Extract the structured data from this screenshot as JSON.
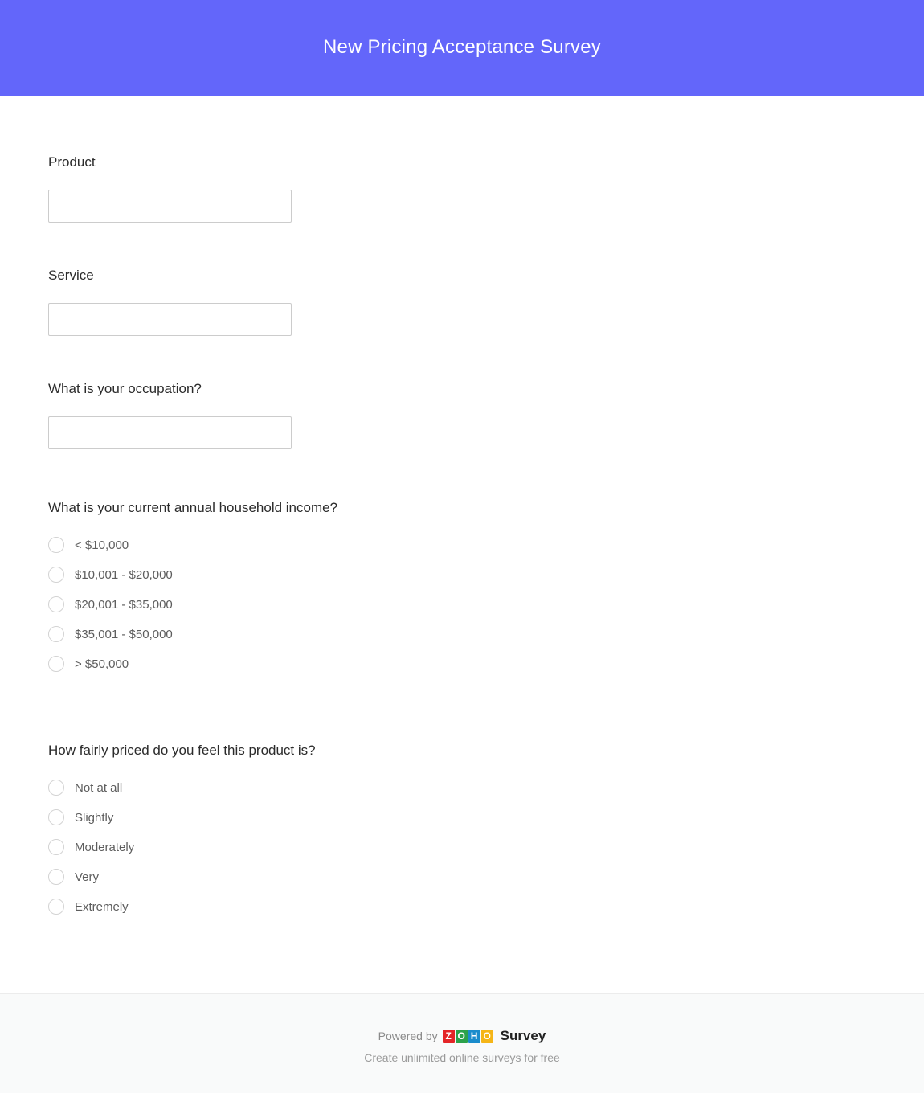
{
  "header": {
    "title": "New Pricing Acceptance Survey",
    "background_color": "#6366fa",
    "title_color": "#ffffff"
  },
  "form": {
    "questions": [
      {
        "id": "product",
        "type": "text",
        "label": "Product",
        "value": "",
        "placeholder": ""
      },
      {
        "id": "service",
        "type": "text",
        "label": "Service",
        "value": "",
        "placeholder": ""
      },
      {
        "id": "occupation",
        "type": "text",
        "label": "What is your occupation?",
        "value": "",
        "placeholder": ""
      },
      {
        "id": "household-income",
        "type": "radio",
        "label": "What is your current annual household income?",
        "selected": null,
        "options": [
          "< $10,000",
          "$10,001 - $20,000",
          "$20,001 - $35,000",
          "$35,001 - $50,000",
          "> $50,000"
        ]
      },
      {
        "id": "price-fairness",
        "type": "radio",
        "label": "How fairly priced do you feel this product is?",
        "selected": null,
        "options": [
          "Not at all",
          "Slightly",
          "Moderately",
          "Very",
          "Extremely"
        ]
      }
    ]
  },
  "footer": {
    "powered_by": "Powered by",
    "brand_tiles": [
      "Z",
      "O",
      "H",
      "O"
    ],
    "brand_tile_colors": [
      "#e42527",
      "#2ca24b",
      "#1a8ccc",
      "#f5b517"
    ],
    "brand_product": "Survey",
    "tagline": "Create unlimited online surveys for free"
  }
}
